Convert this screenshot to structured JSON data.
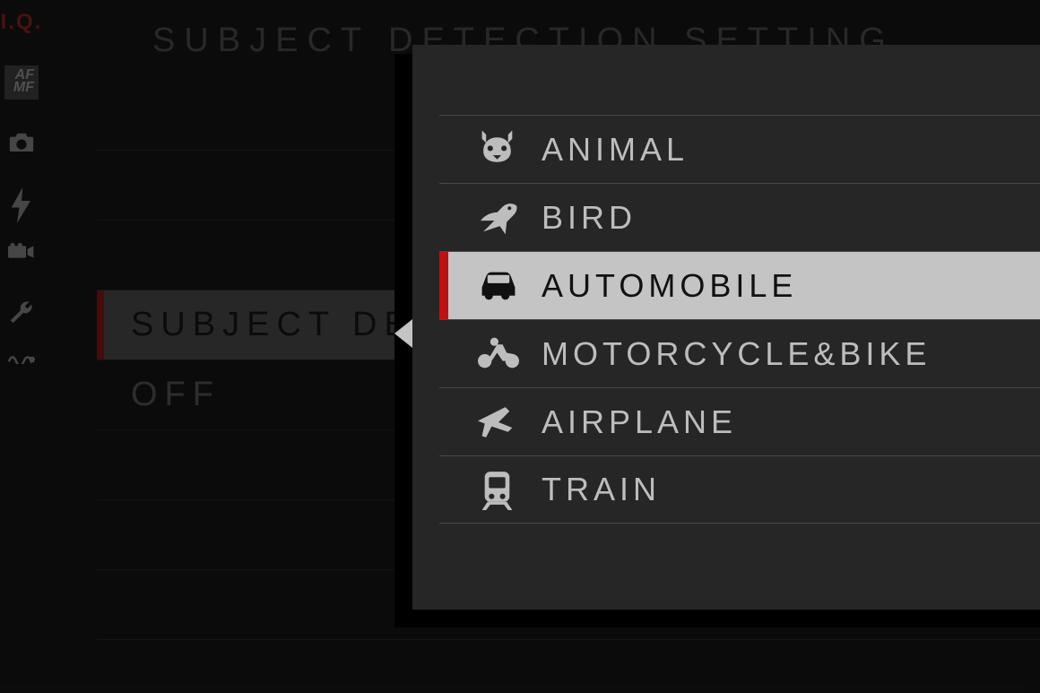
{
  "page_title": "SUBJECT DETECTION SETTING",
  "sidebar": {
    "iq_label": "I.Q.",
    "afmf_top": "AF",
    "afmf_bottom": "MF"
  },
  "background_rows": [
    {
      "label": "",
      "selected": false
    },
    {
      "label": "",
      "selected": false
    },
    {
      "label": "",
      "selected": false
    },
    {
      "label": "SUBJECT DETECTION SETTING",
      "selected": true
    },
    {
      "label": "OFF",
      "selected": false
    },
    {
      "label": "",
      "selected": false
    },
    {
      "label": "",
      "selected": false
    },
    {
      "label": "",
      "selected": false
    }
  ],
  "popup": {
    "selected_index": 2,
    "items": [
      {
        "icon": "animal-icon",
        "label": "ANIMAL"
      },
      {
        "icon": "bird-icon",
        "label": "BIRD"
      },
      {
        "icon": "automobile-icon",
        "label": "AUTOMOBILE"
      },
      {
        "icon": "motorcycle-icon",
        "label": "MOTORCYCLE&BIKE"
      },
      {
        "icon": "airplane-icon",
        "label": "AIRPLANE"
      },
      {
        "icon": "train-icon",
        "label": "TRAIN"
      }
    ]
  },
  "colors": {
    "accent": "#c21010",
    "bg": "#1a1a1a",
    "popup_bg": "#262626",
    "sel_bg": "#c4c4c4"
  }
}
